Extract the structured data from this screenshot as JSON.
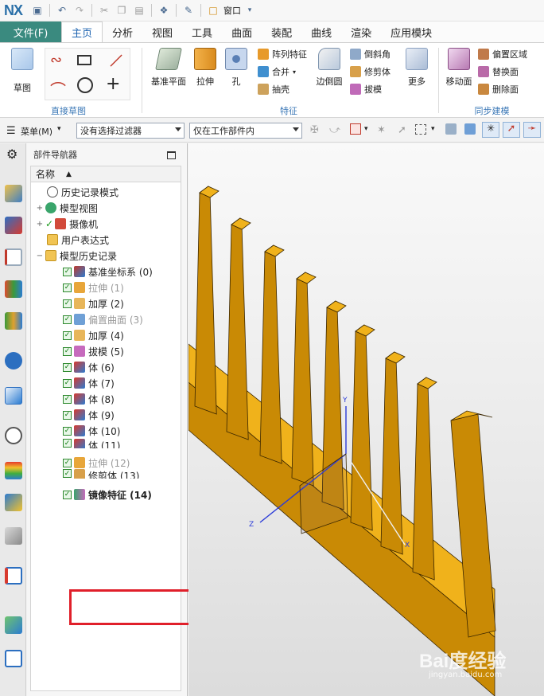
{
  "app": {
    "logo": "NX",
    "window_menu": "窗口"
  },
  "tabs": [
    {
      "label": "文件(F)"
    },
    {
      "label": "主页"
    },
    {
      "label": "分析"
    },
    {
      "label": "视图"
    },
    {
      "label": "工具"
    },
    {
      "label": "曲面"
    },
    {
      "label": "装配"
    },
    {
      "label": "曲线"
    },
    {
      "label": "渲染"
    },
    {
      "label": "应用模块"
    }
  ],
  "ribbon": {
    "sketch_label": "草图",
    "direct_sketch_label": "直接草图",
    "feature_group_label": "特征",
    "sync_group_label": "同步建模",
    "datum_plane_label": "基准平面",
    "extrude_label": "拉伸",
    "hole_label": "孔",
    "pattern_label": "阵列特征",
    "unite_label": "合并",
    "shell_label": "抽壳",
    "edge_blend_label": "边倒圆",
    "chamfer_label": "倒斜角",
    "trim_body_label": "修剪体",
    "draft_label": "拔模",
    "more_label": "更多",
    "move_face_label": "移动面",
    "offset_region_label": "偏置区域",
    "replace_face_label": "替换面",
    "delete_face_label": "删除面"
  },
  "toolbar2": {
    "menu_label": "菜单(M)",
    "filter_value": "没有选择过滤器",
    "scope_value": "仅在工作部件内"
  },
  "navigator": {
    "title": "部件导航器",
    "column_name": "名称",
    "items": [
      {
        "label": "历史记录模式"
      },
      {
        "label": "模型视图"
      },
      {
        "label": "摄像机"
      },
      {
        "label": "用户表达式"
      },
      {
        "label": "模型历史记录"
      },
      {
        "label": "基准坐标系 (0)"
      },
      {
        "label": "拉伸 (1)"
      },
      {
        "label": "加厚 (2)"
      },
      {
        "label": "偏置曲面 (3)"
      },
      {
        "label": "加厚 (4)"
      },
      {
        "label": "拔模 (5)"
      },
      {
        "label": "体 (6)"
      },
      {
        "label": "体 (7)"
      },
      {
        "label": "体 (8)"
      },
      {
        "label": "体 (9)"
      },
      {
        "label": "体 (10)"
      },
      {
        "label": "体 (11)"
      },
      {
        "label": "拉伸 (12)"
      },
      {
        "label": "修剪体 (13)"
      },
      {
        "label": "镜像特征 (14)"
      }
    ]
  },
  "viewport": {
    "axis_y": "Y",
    "axis_z": "Z",
    "axis_x": "X",
    "watermark": "Bai度经验",
    "watermark_url": "jingyan.baidu.com"
  },
  "colors": {
    "part_face": "#f0b21b",
    "part_side": "#c98a05",
    "part_dark": "#a36c03",
    "highlight_box": "#e01f2a",
    "file_tab": "#3a8a7f"
  }
}
